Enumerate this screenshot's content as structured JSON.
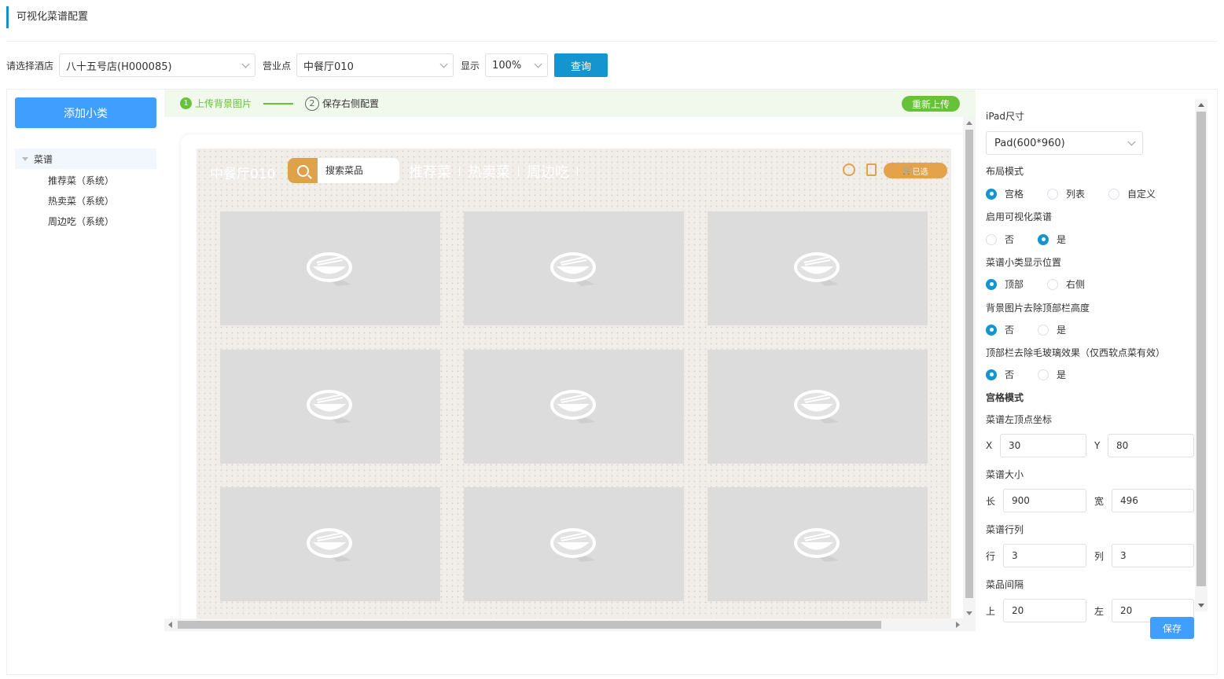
{
  "page_title": "可视化菜谱配置",
  "filters": {
    "hotel_label": "请选择酒店",
    "hotel_value": "八十五号店(H000085)",
    "outlet_label": "营业点",
    "outlet_value": "中餐厅010",
    "display_label": "显示",
    "display_value": "100%",
    "query_button": "查询"
  },
  "sidebar": {
    "add_button": "添加小类",
    "root": "菜谱",
    "items": [
      {
        "label": "推荐菜（系统）"
      },
      {
        "label": "热卖菜（系统）"
      },
      {
        "label": "周边吃（系统）"
      }
    ]
  },
  "steps": {
    "step1_num": "1",
    "step1_label": "上传背景图片",
    "step2_num": "2",
    "step2_label": "保存右侧配置",
    "reupload_button": "重新上传"
  },
  "preview": {
    "title": "中餐厅010",
    "search_placeholder": "搜索菜品",
    "nav": [
      "推荐菜",
      "热卖菜",
      "周边吃"
    ],
    "cart_label": "已选",
    "grid_rows": 3,
    "grid_cols": 3,
    "dish_icon": "bowl-chopsticks-icon"
  },
  "config": {
    "ipad_size_label": "iPad尺寸",
    "ipad_size_value": "Pad(600*960)",
    "layout_label": "布局模式",
    "layout_options": [
      "宫格",
      "列表",
      "自定义"
    ],
    "layout_selected": "宫格",
    "enable_label": "启用可视化菜谱",
    "enable_options": [
      "否",
      "是"
    ],
    "enable_selected": "是",
    "category_pos_label": "菜谱小类显示位置",
    "category_pos_options": [
      "顶部",
      "右侧"
    ],
    "category_pos_selected": "顶部",
    "bg_remove_label": "背景图片去除顶部栏高度",
    "bg_remove_options": [
      "否",
      "是"
    ],
    "bg_remove_selected": "否",
    "frost_label": "顶部栏去除毛玻璃效果（仅西软点菜有效）",
    "frost_options": [
      "否",
      "是"
    ],
    "frost_selected": "否",
    "grid_mode_label": "宫格模式",
    "topleft_label": "菜谱左顶点坐标",
    "x_label": "X",
    "x_value": "30",
    "y_label": "Y",
    "y_value": "80",
    "size_label": "菜谱大小",
    "length_label": "长",
    "length_value": "900",
    "width_label": "宽",
    "width_value": "496",
    "rowcol_label": "菜谱行列",
    "row_label": "行",
    "row_value": "3",
    "col_label": "列",
    "col_value": "3",
    "spacing_label": "菜品间隔",
    "top_label": "上",
    "top_value": "20",
    "left_label": "左",
    "left_value": "20",
    "save_button": "保存"
  },
  "colors": {
    "primary": "#1595cf",
    "button_blue": "#409eff",
    "success": "#67c23a",
    "accent_orange": "#e4a24a"
  }
}
